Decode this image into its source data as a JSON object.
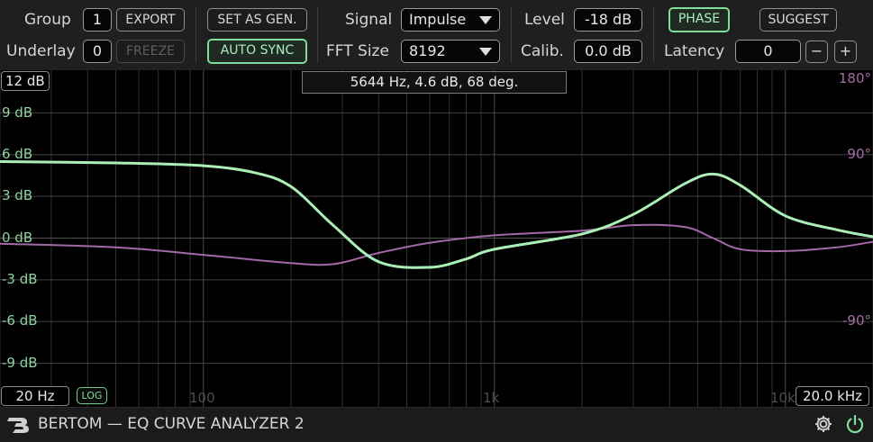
{
  "toolbar": {
    "group_label": "Group",
    "group_value": "1",
    "export_label": "EXPORT",
    "underlay_label": "Underlay",
    "underlay_value": "0",
    "freeze_label": "FREEZE",
    "set_as_gen_label": "SET AS GEN.",
    "auto_sync_label": "AUTO SYNC",
    "signal_label": "Signal",
    "signal_value": "Impulse",
    "fft_label": "FFT Size",
    "fft_value": "8192",
    "level_label": "Level",
    "level_value": "-18 dB",
    "calib_label": "Calib.",
    "calib_value": "0.0 dB",
    "phase_label": "PHASE",
    "suggest_label": "SUGGEST",
    "latency_label": "Latency",
    "latency_value": "0",
    "minus_label": "−",
    "plus_label": "+"
  },
  "analyzer": {
    "readout": "5644 Hz, 4.6 dB, 68 deg.",
    "db_range_top": "12 dB",
    "db_labels": [
      "9 dB",
      "6 dB",
      "3 dB",
      "0 dB",
      "-3 dB",
      "-6 dB",
      "-9 dB"
    ],
    "phase_labels": [
      "180°",
      "90°",
      "-90°"
    ],
    "freq_labels": [
      "100",
      "1k",
      "10k"
    ],
    "freq_min": "20 Hz",
    "freq_max": "20.0 kHz",
    "log_label": "LOG",
    "colors": {
      "magnitude": "#a9efb6",
      "phase": "#a467a8",
      "grid": "#5a5a5a",
      "db_label": "#8fd49f",
      "phase_label": "#a66aa6"
    }
  },
  "chart_data": {
    "type": "line",
    "x_scale": "log",
    "xlim": [
      20,
      20000
    ],
    "ylim": [
      -12,
      12
    ],
    "y2lim": [
      -180,
      180
    ],
    "series": [
      {
        "axis": "dB",
        "x": [
          20,
          50,
          100,
          150,
          200,
          280,
          400,
          600,
          800,
          1000,
          2000,
          3000,
          4500,
          5644,
          7000,
          10000,
          15000,
          20000
        ],
        "y": [
          5.5,
          5.4,
          5.2,
          4.7,
          3.7,
          0.9,
          -1.7,
          -2.1,
          -1.5,
          -0.8,
          0.3,
          1.7,
          3.9,
          4.6,
          3.8,
          1.6,
          0.6,
          0.1
        ]
      },
      {
        "axis": "deg",
        "x": [
          20,
          50,
          100,
          200,
          280,
          400,
          600,
          1000,
          2000,
          3000,
          4500,
          5644,
          7000,
          10000,
          15000,
          20000
        ],
        "y": [
          -6,
          -10,
          -18,
          -27,
          -28,
          -16,
          -5,
          3,
          8,
          14,
          12,
          0,
          -12,
          -14,
          -10,
          -4
        ]
      }
    ]
  },
  "footer": {
    "brand": "BERTOM — EQ CURVE ANALYZER 2"
  }
}
